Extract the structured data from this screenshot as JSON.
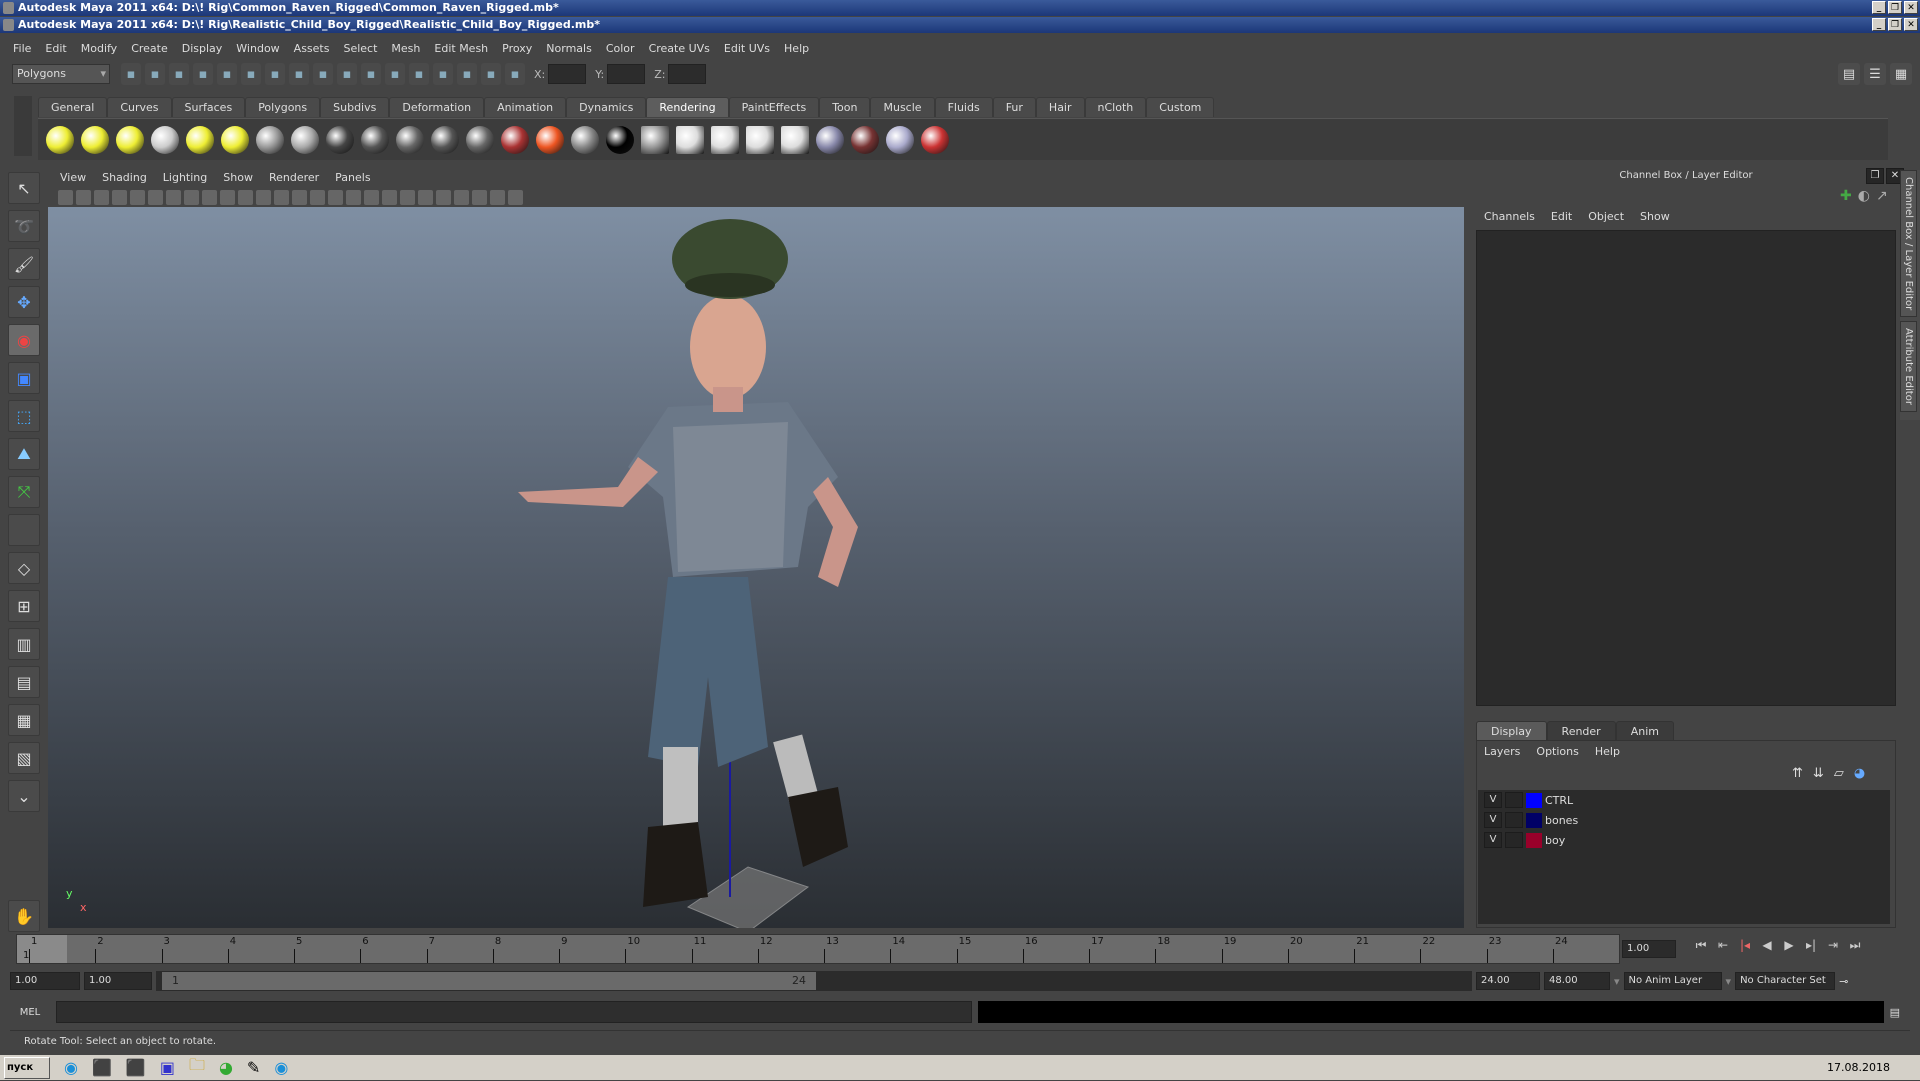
{
  "windows": [
    {
      "title": "Autodesk Maya 2011 x64: D:\\! Rig\\Common_Raven_Rigged\\Common_Raven_Rigged.mb*"
    },
    {
      "title": "Autodesk Maya 2011 x64: D:\\! Rig\\Realistic_Child_Boy_Rigged\\Realistic_Child_Boy_Rigged.mb*"
    }
  ],
  "menu": [
    "File",
    "Edit",
    "Modify",
    "Create",
    "Display",
    "Window",
    "Assets",
    "Select",
    "Mesh",
    "Edit Mesh",
    "Proxy",
    "Normals",
    "Color",
    "Create UVs",
    "Edit UVs",
    "Help"
  ],
  "statusline": {
    "menuset": "Polygons",
    "x_label": "X:",
    "y_label": "Y:",
    "z_label": "Z:"
  },
  "shelf_tabs": [
    "General",
    "Curves",
    "Surfaces",
    "Polygons",
    "Subdivs",
    "Deformation",
    "Animation",
    "Dynamics",
    "Rendering",
    "PaintEffects",
    "Toon",
    "Muscle",
    "Fluids",
    "Fur",
    "Hair",
    "nCloth",
    "Custom"
  ],
  "shelf_active": "Rendering",
  "shelf_icons": [
    "ambient-light",
    "directional-light",
    "point-light",
    "spot-light",
    "area-light",
    "volume-light",
    "camera",
    "render-view",
    "blinn",
    "lambert",
    "phong",
    "phongE",
    "anisotropic",
    "layered-shader",
    "ramp-shader",
    "surface-shader",
    "use-background",
    "shading-map",
    "render-current-frame",
    "ipr-render",
    "batch-render",
    "render-settings",
    "hypershade",
    "remove-material",
    "material-viewer",
    "paint-canvas"
  ],
  "panel_menu": [
    "View",
    "Shading",
    "Lighting",
    "Show",
    "Renderer",
    "Panels"
  ],
  "axis": {
    "y": "y",
    "x": "x"
  },
  "channel_box": {
    "title": "Channel Box / Layer Editor",
    "menu": [
      "Channels",
      "Edit",
      "Object",
      "Show"
    ]
  },
  "layer_editor": {
    "tabs": [
      "Display",
      "Render",
      "Anim"
    ],
    "active_tab": "Display",
    "menu": [
      "Layers",
      "Options",
      "Help"
    ],
    "layers": [
      {
        "visible": "V",
        "name": "CTRL",
        "color": "#0000ff"
      },
      {
        "visible": "V",
        "name": "bones",
        "color": "#000066"
      },
      {
        "visible": "V",
        "name": "boy",
        "color": "#99002a"
      }
    ]
  },
  "side_tabs": [
    "Channel Box / Layer Editor",
    "Attribute Editor"
  ],
  "timeline": {
    "ticks": [
      "1",
      "2",
      "3",
      "4",
      "5",
      "6",
      "7",
      "8",
      "9",
      "10",
      "11",
      "12",
      "13",
      "14",
      "15",
      "16",
      "17",
      "18",
      "19",
      "20",
      "21",
      "22",
      "23",
      "24"
    ],
    "current_frame_marker": "1",
    "current_time": "1.00"
  },
  "range": {
    "start": "1.00",
    "playback_start": "1.00",
    "slider_start": "1",
    "slider_end": "24",
    "playback_end": "24.00",
    "end": "48.00",
    "anim_layer": "No Anim Layer",
    "character_set": "No Character Set"
  },
  "command_line": {
    "label": "MEL"
  },
  "help_line": "Rotate Tool: Select an object to rotate.",
  "taskbar": {
    "start": "пуск",
    "date": "17.08.2018"
  }
}
